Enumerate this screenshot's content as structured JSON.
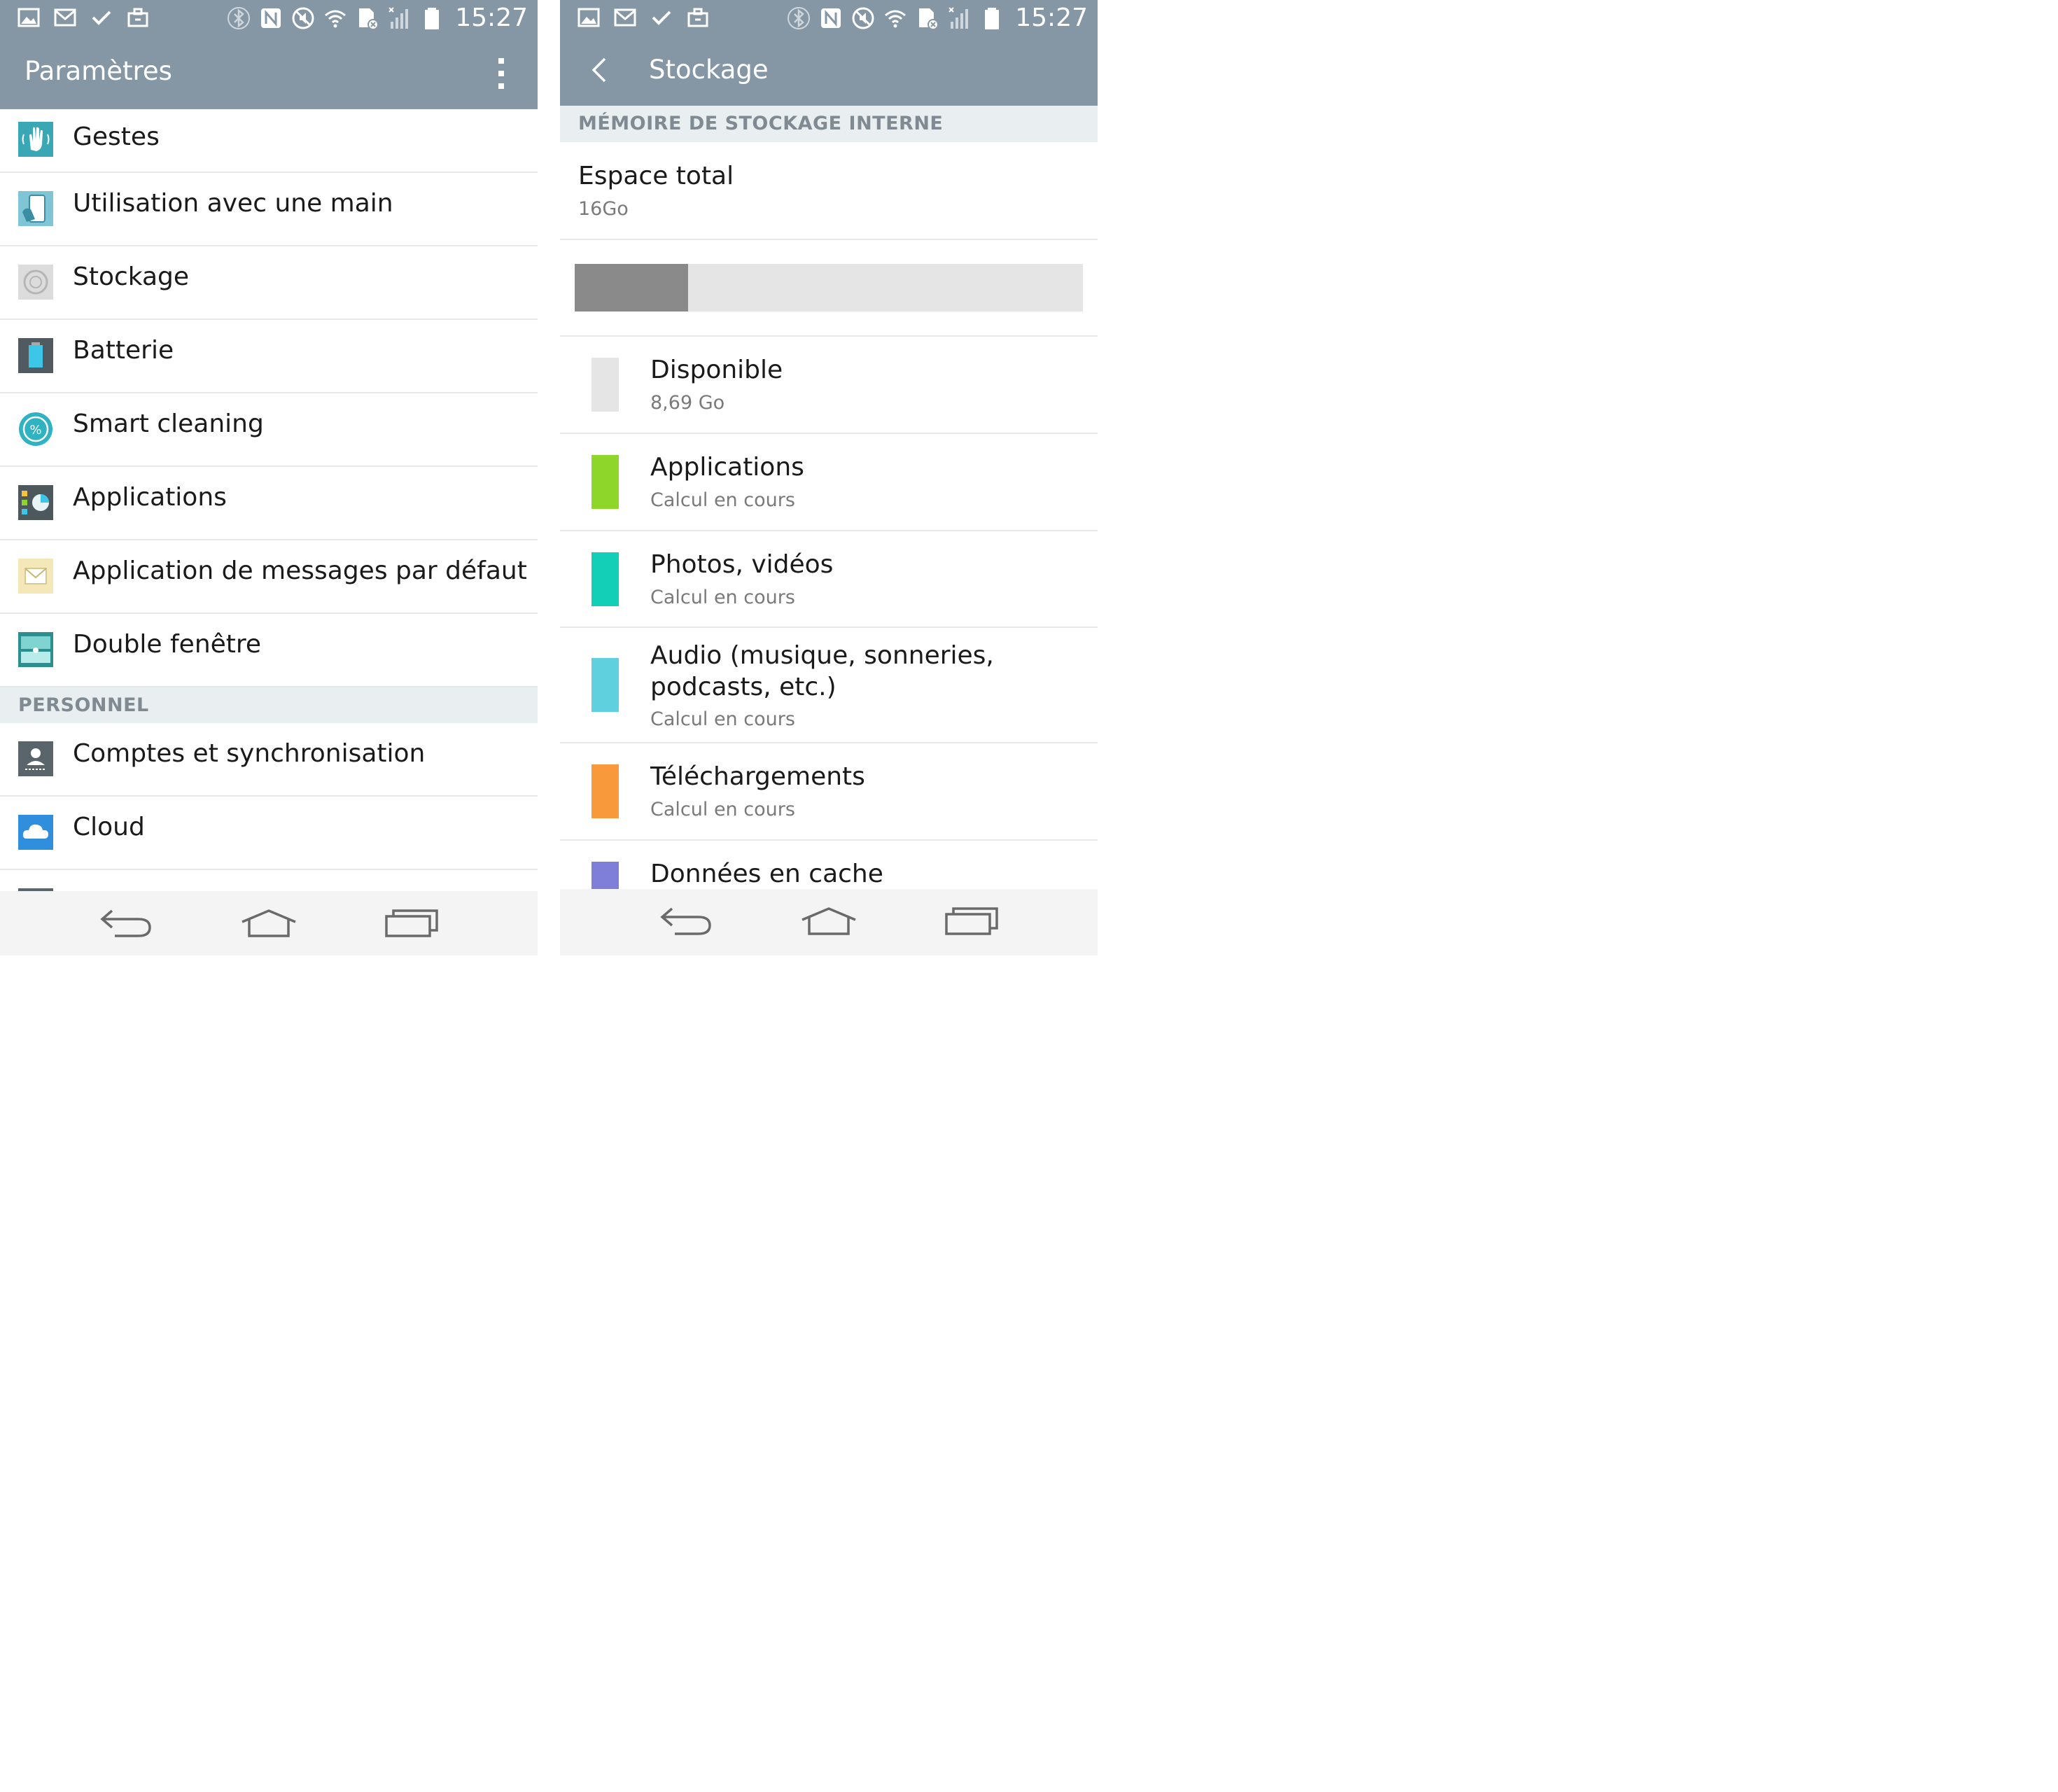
{
  "status_bar": {
    "time": "15:27"
  },
  "left": {
    "title": "Paramètres",
    "items": [
      {
        "label": "Gestes"
      },
      {
        "label": "Utilisation avec une main"
      },
      {
        "label": "Stockage"
      },
      {
        "label": "Batterie"
      },
      {
        "label": "Smart cleaning"
      },
      {
        "label": "Applications"
      },
      {
        "label": "Application de messages par défaut"
      },
      {
        "label": "Double fenêtre"
      }
    ],
    "section_personal": "PERSONNEL",
    "personal_items": [
      {
        "label": "Comptes et synchronisation"
      },
      {
        "label": "Cloud"
      }
    ]
  },
  "right": {
    "title": "Stockage",
    "section": "MÉMOIRE DE STOCKAGE INTERNE",
    "total_label": "Espace total",
    "total_value": "16Go",
    "used_fraction": 0.223,
    "categories": [
      {
        "name": "Disponible",
        "value": "8,69 Go",
        "color": "#e5e5e5"
      },
      {
        "name": "Applications",
        "value": "Calcul en cours",
        "color": "#8fd62a"
      },
      {
        "name": "Photos, vidéos",
        "value": "Calcul en cours",
        "color": "#14cfb8"
      },
      {
        "name_line1": "Audio (musique, sonneries,",
        "name_line2": "podcasts, etc.)",
        "value": "Calcul en cours",
        "color": "#5fd0dd"
      },
      {
        "name": "Téléchargements",
        "value": "Calcul en cours",
        "color": "#f89a3b"
      },
      {
        "name": "Données en cache",
        "color": "#7f7fd9"
      }
    ]
  },
  "colors": {
    "header": "#8597a4",
    "section_bg": "#e9eef1",
    "bar_used": "#8a8a8a",
    "bar_track": "#e5e5e5"
  }
}
